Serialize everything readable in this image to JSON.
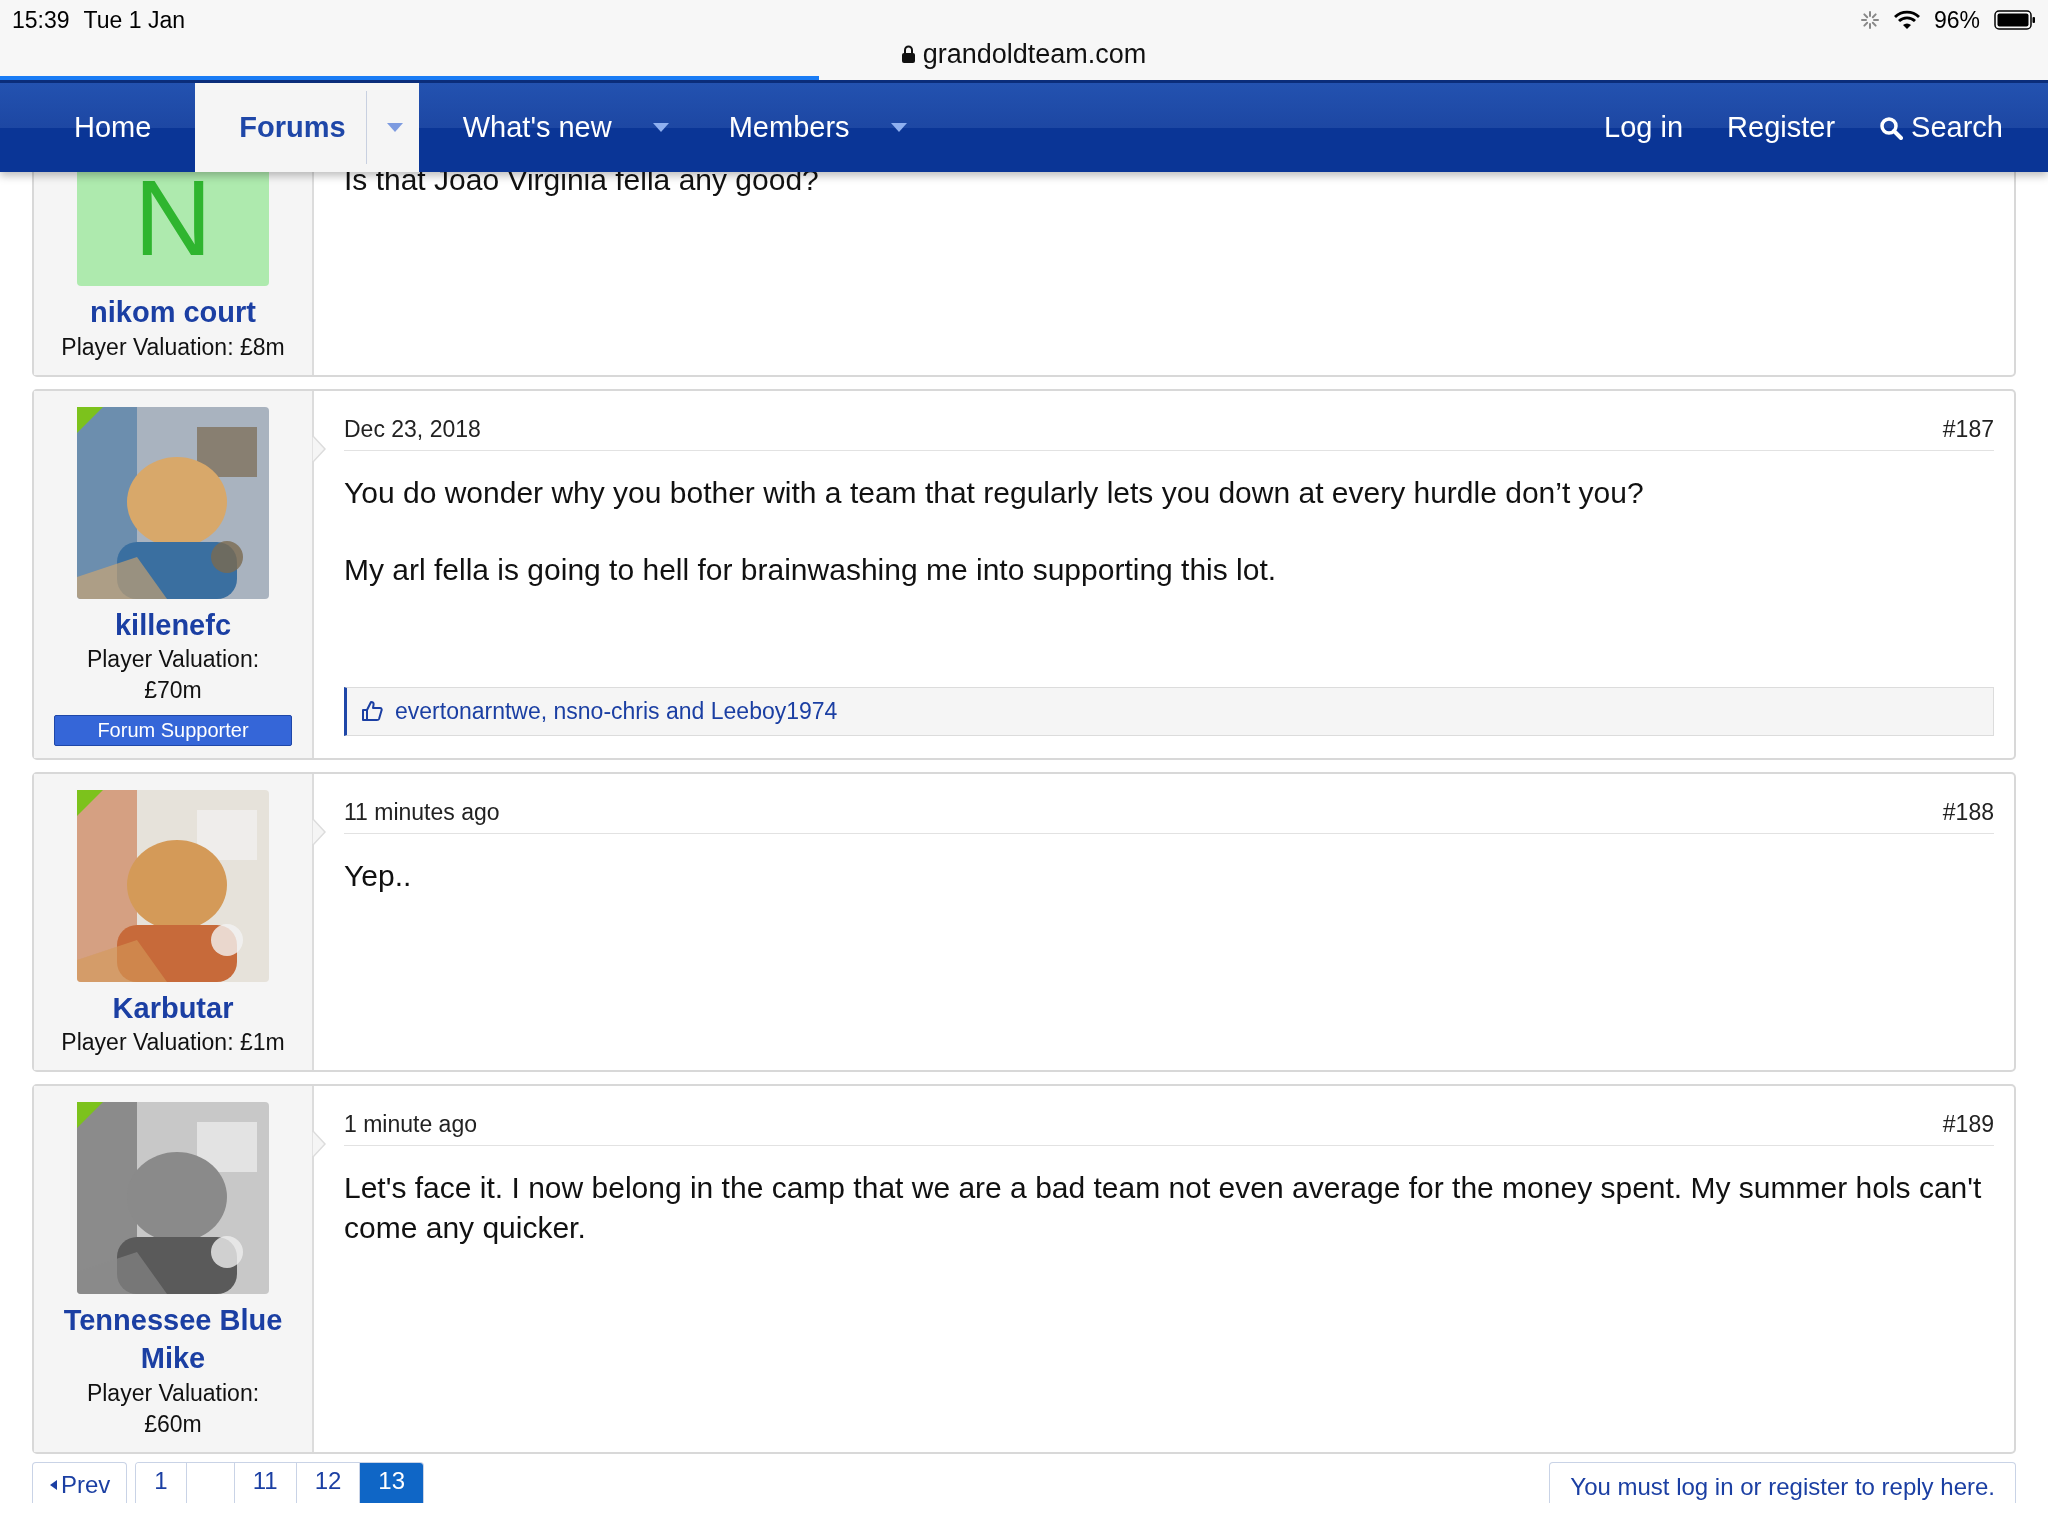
{
  "status_bar": {
    "time": "15:39",
    "date": "Tue 1 Jan",
    "battery": "96%"
  },
  "address_bar": {
    "url": "grandoldteam.com",
    "level": 0.4
  },
  "nav": {
    "items": [
      {
        "label": "Home",
        "selected": false,
        "dropdown": false
      },
      {
        "label": "Forums",
        "selected": true,
        "dropdown": true
      },
      {
        "label": "What's new",
        "selected": false,
        "dropdown": true
      },
      {
        "label": "Members",
        "selected": false,
        "dropdown": true
      }
    ],
    "right": [
      {
        "label": "Log in",
        "kind": "link"
      },
      {
        "label": "Register",
        "kind": "link"
      },
      {
        "label": "Search",
        "kind": "search"
      }
    ]
  },
  "posts": [
    {
      "avatar": {
        "kind": "letter",
        "letter": "N"
      },
      "online": false,
      "username": "nikom court",
      "valuation": "Player Valuation: £8m",
      "message": [
        "Is that Joao Virginia fella any good?"
      ]
    },
    {
      "avatar": {
        "kind": "picture"
      },
      "online": true,
      "username": "killenefc",
      "valuation": "Player Valuation: £70m",
      "banner": "Forum Supporter",
      "date": "Dec 23, 2018",
      "number": "#187",
      "message": [
        "You do wonder why you bother with a team that regularly lets you down at every hurdle don’t you?",
        "My arl fella is going to hell for brainwashing me into supporting this lot."
      ],
      "likes": "evertonarntwe, nsno-chris and Leeboy1974"
    },
    {
      "avatar": {
        "kind": "picture"
      },
      "online": true,
      "username": "Karbutar",
      "valuation": "Player Valuation: £1m",
      "date": "11 minutes ago",
      "number": "#188",
      "message": [
        "Yep.."
      ]
    },
    {
      "avatar": {
        "kind": "picture"
      },
      "online": true,
      "username": "Tennessee Blue Mike",
      "valuation": "Player Valuation: £60m",
      "date": "1 minute ago",
      "number": "#189",
      "message": [
        "Let's face it. I now belong in the camp that we are a bad team not even average for the money spent. My summer hols can't come any quicker."
      ]
    }
  ],
  "pagination": {
    "prev": "Prev",
    "pages": [
      {
        "kind": "page",
        "label": "1",
        "selected": false
      },
      {
        "kind": "gap"
      },
      {
        "kind": "page",
        "label": "11",
        "selected": false
      },
      {
        "kind": "page",
        "label": "12",
        "selected": false
      },
      {
        "kind": "page",
        "label": "13",
        "selected": true
      }
    ]
  },
  "reply_notice": "You must log in or register to reply here."
}
